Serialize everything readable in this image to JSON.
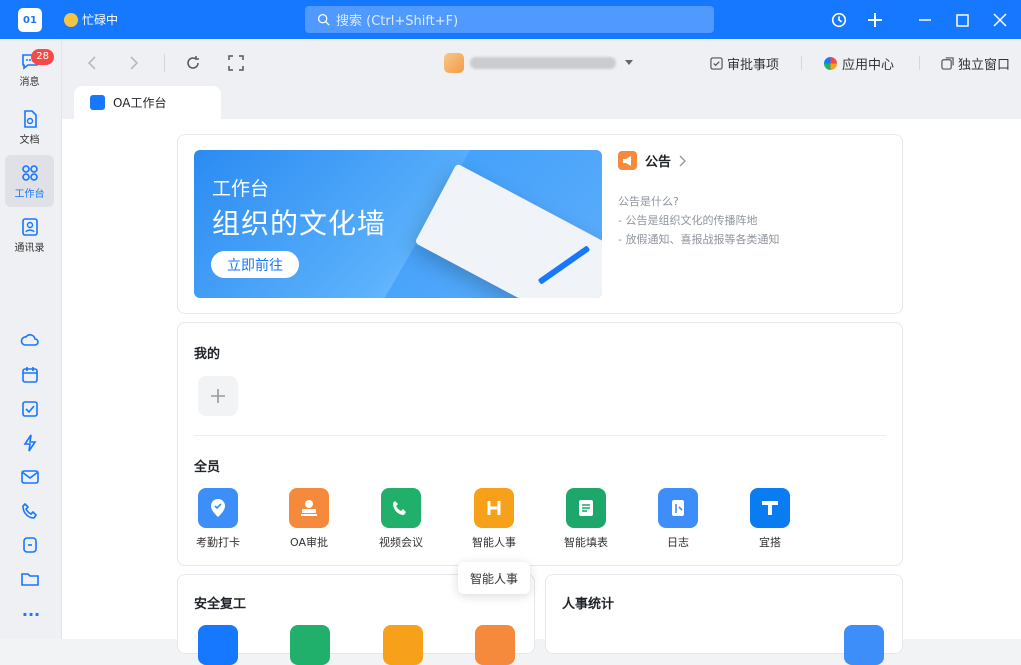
{
  "titlebar": {
    "avatar_text": "01",
    "status_text": "忙碌中",
    "search_placeholder": "搜索 (Ctrl+Shift+F)"
  },
  "sidebar": {
    "items": [
      {
        "label": "消息",
        "icon": "chat-icon",
        "badge": "28"
      },
      {
        "label": "文档",
        "icon": "document-icon"
      },
      {
        "label": "工作台",
        "icon": "workbench-icon"
      },
      {
        "label": "通讯录",
        "icon": "contacts-icon"
      }
    ],
    "more": "···"
  },
  "toolbar": {
    "approval": "审批事项",
    "app_center": "应用中心",
    "standalone": "独立窗口"
  },
  "tab": {
    "label": "OA工作台"
  },
  "banner": {
    "title": "工作台",
    "subtitle": "组织的文化墙",
    "button": "立即前往"
  },
  "notice": {
    "title": "公告",
    "line1": "公告是什么?",
    "line2": "- 公告是组织文化的传播阵地",
    "line3": "- 放假通知、喜报战报等各类通知"
  },
  "mine": {
    "title": "我的"
  },
  "all": {
    "title": "全员",
    "apps": [
      {
        "label": "考勤打卡",
        "color": "#3d8ef8"
      },
      {
        "label": "OA审批",
        "color": "#f68a3c"
      },
      {
        "label": "视频会议",
        "color": "#21b06c"
      },
      {
        "label": "智能人事",
        "color": "#f7a11a"
      },
      {
        "label": "智能填表",
        "color": "#1ea76a"
      },
      {
        "label": "日志",
        "color": "#3d8ef8"
      },
      {
        "label": "宜搭",
        "color": "#0a7cf2"
      }
    ]
  },
  "tooltip": "智能人事",
  "safety": {
    "title": "安全复工"
  },
  "hr_stats": {
    "title": "人事统计"
  }
}
